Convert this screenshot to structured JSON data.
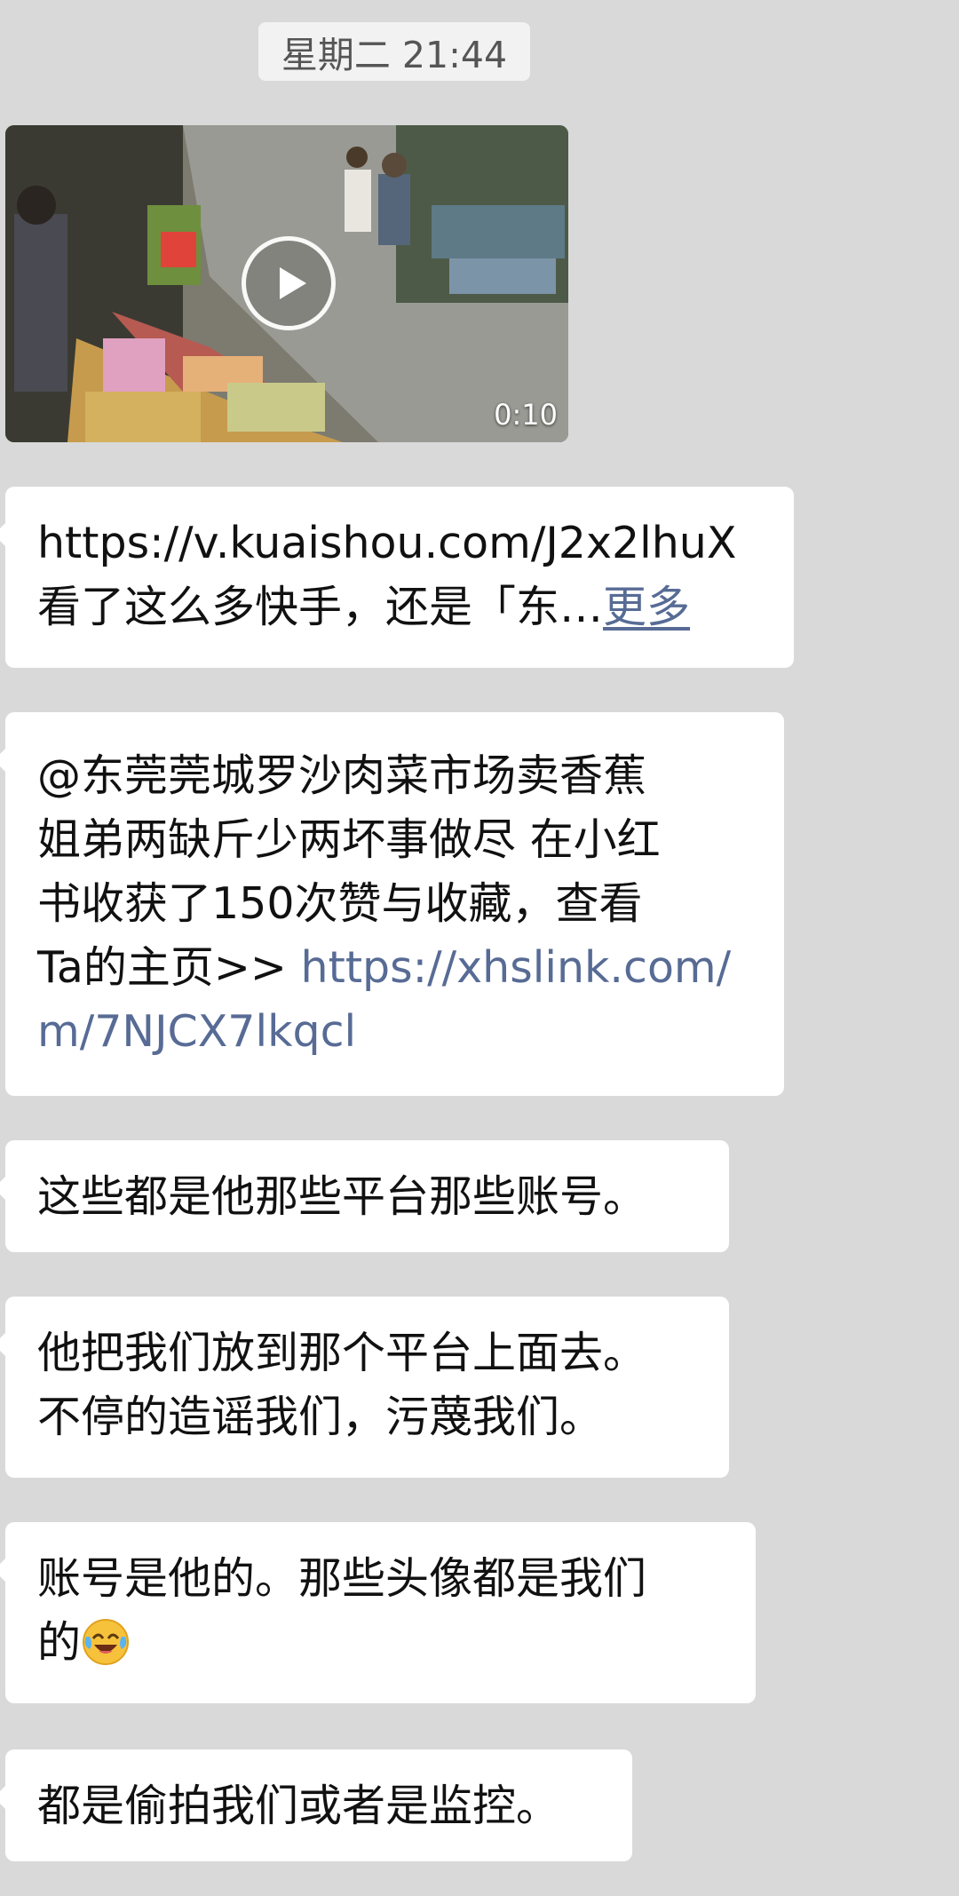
{
  "timestamp": "星期二 21:44",
  "video": {
    "duration": "0:10",
    "play_icon": "play-icon"
  },
  "messages": [
    {
      "lines": [
        "https://v.kuaishou.com/J2x2lhuX",
        "看了这么多快手，还是「东…"
      ],
      "more": "更多"
    },
    {
      "lines": [
        "@东莞莞城罗沙肉菜市场卖香蕉",
        "姐弟两缺斤少两坏事做尽 在小红",
        "书收获了150次赞与收藏，查看",
        "Ta的主页>> "
      ],
      "link": [
        "https://xhslink.com/",
        "m/7NJCX7lkqcl"
      ]
    },
    {
      "lines": [
        "这些都是他那些平台那些账号。"
      ]
    },
    {
      "lines": [
        "他把我们放到那个平台上面去。",
        "不停的造谣我们，污蔑我们。"
      ]
    },
    {
      "lines": [
        "账号是他的。那些头像都是我们",
        "的"
      ],
      "emoji": "crying-laughing-emoji"
    },
    {
      "lines": [
        "都是偷拍我们或者是监控。"
      ]
    }
  ]
}
